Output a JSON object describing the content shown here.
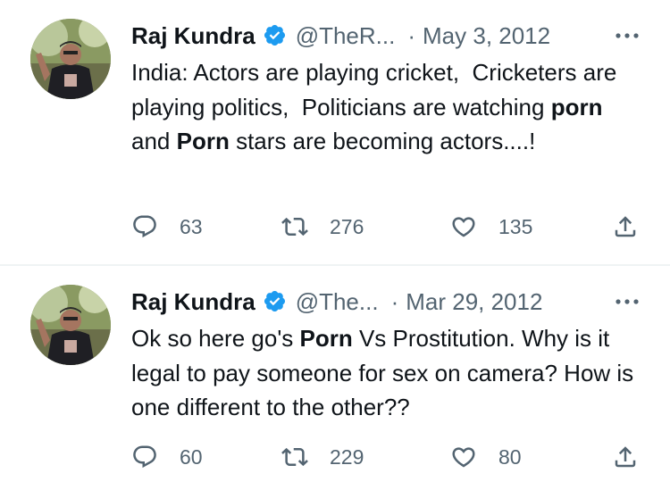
{
  "tweets": [
    {
      "author": {
        "display_name": "Raj Kundra",
        "handle": "@TheR...",
        "verified_icon": "verified-badge-icon"
      },
      "separator": "·",
      "date": "May 3, 2012",
      "text_parts": [
        "India: Actors are playing cricket,  Cricketers are playing politics,  Politicians are watching ",
        "porn",
        "  and ",
        "Porn",
        " stars are becoming actors....!"
      ],
      "stats": {
        "replies": "63",
        "retweets": "276",
        "likes": "135"
      }
    },
    {
      "author": {
        "display_name": "Raj Kundra",
        "handle": "@The...",
        "verified_icon": "verified-badge-icon"
      },
      "separator": "·",
      "date": "Mar 29, 2012",
      "text_parts": [
        "Ok so here go's ",
        "Porn",
        " Vs Prostitution. Why is it legal to pay someone for sex on camera? How is one different to the other??"
      ],
      "stats": {
        "replies": "60",
        "retweets": "229",
        "likes": "80"
      }
    }
  ],
  "colors": {
    "text_primary": "#0f1419",
    "text_secondary": "#536471",
    "verified_blue": "#1d9bf0",
    "divider": "#eff3f4"
  },
  "icons": [
    "reply-icon",
    "retweet-icon",
    "like-icon",
    "share-icon",
    "more-icon",
    "verified-badge-icon"
  ]
}
